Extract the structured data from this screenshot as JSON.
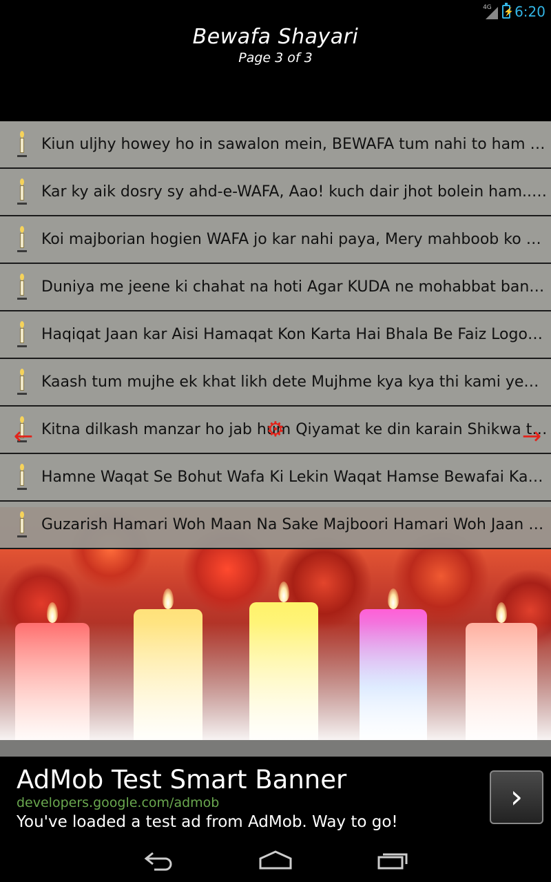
{
  "status_bar": {
    "network": "4G",
    "time": "6:20"
  },
  "header": {
    "title": "Bewafa Shayari",
    "page_indicator": "Page 3 of 3"
  },
  "shayari_list": [
    "Kiun uljhy howey ho in sawalon mein, BEWAFA tum nahi to ham hon g...",
    "Kar ky aik dosry sy ahd-e-WAFA, Aao! kuch dair jhot bolein ham...!!!",
    "Koi majborian hogien WAFA jo kar nahi paya, Mery mahboob ko shamil...",
    "Duniya me jeene ki chahat na hoti Agar KUDA ne mohabbat banayi na h...",
    "Haqiqat Jaan kar Aisi Hamaqat Kon Karta Hai Bhala Be Faiz Logon Se M...",
    "Kaash tum mujhe ek khat likh dete Mujhme kya kya thi kami yeh to bat...",
    "Kitna dilkash manzar ho jab hum Qiyamat ke din karain Shikwa teri Be...",
    "Hamne Waqat Se Bohut Wafa Ki Lekin Waqat Hamse Bewafai Kar Gaya...",
    "Guzarish Hamari Woh Maan Na Sake Majboori Hamari Woh Jaan Na Sak..."
  ],
  "navigation": {
    "prev_icon": "arrow-left-icon",
    "home_icon": "home-gear-icon",
    "next_icon": "arrow-right-icon",
    "accent_color": "#e2231a"
  },
  "ad": {
    "title": "AdMob Test Smart Banner",
    "url": "developers.google.com/admob",
    "description": "You've loaded a test ad from AdMob. Way to go!"
  },
  "system_nav": {
    "back_icon": "back-icon",
    "home_icon": "home-icon",
    "recents_icon": "recents-icon"
  }
}
